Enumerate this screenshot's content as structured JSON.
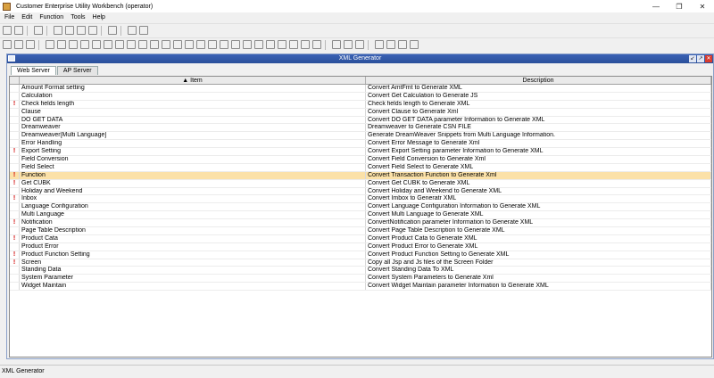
{
  "window": {
    "title": "Customer Enterprise Utility Workbench    (operator)",
    "min_icon": "minimize-icon",
    "max_icon": "maximize-icon",
    "close_icon": "close-icon"
  },
  "menu": [
    "File",
    "Edit",
    "Function",
    "Tools",
    "Help"
  ],
  "internal_frame": {
    "title": "XML Generator",
    "accent": "#2a4f9a"
  },
  "tabs": [
    "Web Server",
    "AP Server"
  ],
  "table": {
    "columns": [
      "",
      "Item",
      "Description"
    ],
    "rows": [
      {
        "flag": "",
        "item": "Amount Format setting",
        "desc": "Convert AmtFmt to Generate XML"
      },
      {
        "flag": "",
        "item": "Calculation",
        "desc": "Convert Get Calculation to Generate JS"
      },
      {
        "flag": "!",
        "item": "Check fields length",
        "desc": "Check fields length to Generate XML"
      },
      {
        "flag": "",
        "item": "Clause",
        "desc": "Convert Clause to Generate Xml"
      },
      {
        "flag": "",
        "item": "DO GET DATA",
        "desc": "Convert DO GET DATA parameter Information to Generate XML"
      },
      {
        "flag": "",
        "item": "Dreamweaver",
        "desc": "Dreamweaver to Generate CSN FILE"
      },
      {
        "flag": "",
        "item": "Dreamweaver[Multi Language]",
        "desc": "Generate DreamWeaver Snippets from Multi Language Information."
      },
      {
        "flag": "",
        "item": "Error Handling",
        "desc": "Convert Error Message to Generate Xml"
      },
      {
        "flag": "!",
        "item": "Export Setting",
        "desc": "Convert Export Setting parameter Information to Generate XML"
      },
      {
        "flag": "",
        "item": "Field Conversion",
        "desc": "Convert Field Conversion to Generate Xml"
      },
      {
        "flag": "",
        "item": "Field Select",
        "desc": "Convert Field Select to Generate XML"
      },
      {
        "flag": "!",
        "item": "Function",
        "desc": "Convert Transaction Function to Generate Xml",
        "selected": true
      },
      {
        "flag": "!",
        "item": "Get CUBK",
        "desc": "Convert Get CUBK to Generate XML"
      },
      {
        "flag": "",
        "item": "Holiday and Weekend",
        "desc": "Convert Holiday and Weekend to Generate XML"
      },
      {
        "flag": "!",
        "item": "Inbox",
        "desc": "Convert Imbox to Generatr XML"
      },
      {
        "flag": "",
        "item": "Language Configuration",
        "desc": "Convert Language Configuration Information to Generate XML"
      },
      {
        "flag": "",
        "item": "Multi Language",
        "desc": "Convert Multi Language to Generate XML"
      },
      {
        "flag": "!",
        "item": "Notification",
        "desc": "ConvertNotification parameter Information to Generate XML"
      },
      {
        "flag": "",
        "item": "Page Table Description",
        "desc": "Convert Page Table Description to Generate XML"
      },
      {
        "flag": "!",
        "item": "Product Cata",
        "desc": "Convert Product Cata to Generate XML"
      },
      {
        "flag": "",
        "item": "Product Error",
        "desc": "Convert Product Error to Generate XML"
      },
      {
        "flag": "!",
        "item": "Product Function Setting",
        "desc": "Convert Product Function Setting to Generate XML"
      },
      {
        "flag": "!",
        "item": "Screen",
        "desc": "Copy all Jsp and Js files of the Screen Folder"
      },
      {
        "flag": "",
        "item": "Standing Data",
        "desc": "Convert Standing Data To XML"
      },
      {
        "flag": "",
        "item": "System Parameter",
        "desc": "Convert System Parameters to Generate Xml"
      },
      {
        "flag": "",
        "item": "Widget Maintain",
        "desc": "Convert Widget Maintain parameter Information to Generate XML"
      }
    ]
  },
  "status": "XML Generator",
  "colors": {
    "selected_row": "#fbe1a8",
    "flag": "#d00000",
    "frame_title": "#2a4f9a"
  }
}
